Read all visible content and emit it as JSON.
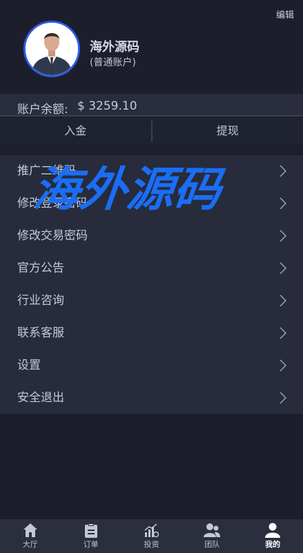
{
  "header": {
    "edit_label": "编辑",
    "username": "海外源码",
    "account_type": "(普通账户)"
  },
  "balance": {
    "label": "账户余额:",
    "value": "$ 3259.10"
  },
  "actions": {
    "deposit": "入金",
    "withdraw": "提现"
  },
  "menu": [
    {
      "label": "推广二维码"
    },
    {
      "label": "修改登录密码"
    },
    {
      "label": "修改交易密码"
    },
    {
      "label": "官方公告"
    },
    {
      "label": "行业咨询"
    },
    {
      "label": "联系客服"
    },
    {
      "label": "设置"
    },
    {
      "label": "安全退出"
    }
  ],
  "watermark": "海外源码",
  "tabs": [
    {
      "label": "大厅",
      "icon": "home-icon"
    },
    {
      "label": "订单",
      "icon": "clipboard-icon"
    },
    {
      "label": "投资",
      "icon": "chart-icon"
    },
    {
      "label": "团队",
      "icon": "team-icon"
    },
    {
      "label": "我的",
      "icon": "user-icon",
      "active": true
    }
  ],
  "colors": {
    "background": "#1c1f2b",
    "panel": "#272b3b",
    "accent": "#2d5ce8",
    "watermark": "#1a6ef5"
  }
}
